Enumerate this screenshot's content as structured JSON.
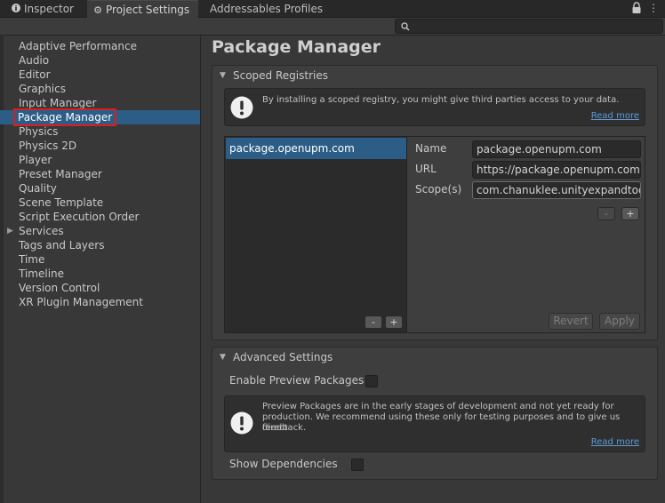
{
  "tabs": [
    {
      "label": "Inspector",
      "icon": "info-icon",
      "active": false
    },
    {
      "label": "Project Settings",
      "icon": "gear-icon",
      "active": true
    },
    {
      "label": "Addressables Profiles",
      "icon": "",
      "active": false
    }
  ],
  "search": {
    "placeholder": ""
  },
  "sidebar": {
    "items": [
      {
        "label": "Adaptive Performance"
      },
      {
        "label": "Audio"
      },
      {
        "label": "Editor"
      },
      {
        "label": "Graphics"
      },
      {
        "label": "Input Manager"
      },
      {
        "label": "Package Manager",
        "selected": true
      },
      {
        "label": "Physics"
      },
      {
        "label": "Physics 2D"
      },
      {
        "label": "Player"
      },
      {
        "label": "Preset Manager"
      },
      {
        "label": "Quality"
      },
      {
        "label": "Scene Template"
      },
      {
        "label": "Script Execution Order"
      },
      {
        "label": "Services",
        "expandable": true
      },
      {
        "label": "Tags and Layers"
      },
      {
        "label": "Time"
      },
      {
        "label": "Timeline"
      },
      {
        "label": "Version Control"
      },
      {
        "label": "XR Plugin Management"
      }
    ]
  },
  "main": {
    "title": "Package Manager",
    "scoped": {
      "header": "Scoped Registries",
      "warning": "By installing a scoped registry, you might give third parties access to your data.",
      "read_more": "Read more",
      "registry_item": "package.openupm.com",
      "fields": {
        "name_label": "Name",
        "name_value": "package.openupm.com",
        "url_label": "URL",
        "url_value": "https://package.openupm.com",
        "scope_label": "Scope(s)",
        "scope_value": "com.chanuklee.unityexpandtool"
      },
      "minus": "-",
      "plus": "+",
      "revert": "Revert",
      "apply": "Apply"
    },
    "advanced": {
      "header": "Advanced Settings",
      "enable_preview": "Enable Preview Packages",
      "preview_line1": "Preview Packages are in the early stages of development and not yet ready for",
      "preview_line2": "production. We recommend using these only for testing purposes and to give us direct",
      "preview_line3": "feedback.",
      "read_more": "Read more",
      "show_dependencies": "Show Dependencies"
    }
  },
  "colors": {
    "selection": "#2c5d87",
    "highlight_outline": "#e01b1b",
    "link": "#5c9bd6"
  }
}
